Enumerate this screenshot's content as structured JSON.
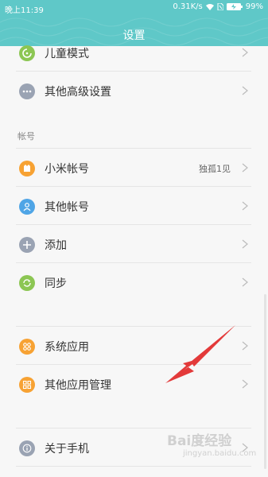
{
  "status_bar": {
    "time": "晚上11:39",
    "speed": "0.31K/s",
    "battery": "99%"
  },
  "header": {
    "title": "设置"
  },
  "settings": {
    "top_items": [
      {
        "label": "儿童模式",
        "icon": "child-mode-icon",
        "color": "#8cc653"
      },
      {
        "label": "其他高级设置",
        "icon": "more-settings-icon",
        "color": "#9aa3b3"
      }
    ],
    "account_section": {
      "title": "帐号",
      "items": [
        {
          "label": "小米帐号",
          "value": "独孤1见",
          "icon": "mi-account-icon",
          "color": "#f7a233"
        },
        {
          "label": "其他帐号",
          "icon": "user-account-icon",
          "color": "#4fa5e6"
        },
        {
          "label": "添加",
          "icon": "plus-icon",
          "color": "#9aa3b3"
        },
        {
          "label": "同步",
          "icon": "sync-icon",
          "color": "#8cc653"
        }
      ]
    },
    "apps_items": [
      {
        "label": "系统应用",
        "icon": "system-apps-icon",
        "color": "#f7a233"
      },
      {
        "label": "其他应用管理",
        "icon": "app-management-icon",
        "color": "#f7a233"
      }
    ],
    "about_item": {
      "label": "关于手机",
      "icon": "info-icon",
      "color": "#9aa3b3"
    }
  },
  "watermark": {
    "text": "Bai度经验",
    "url": "jingyan.baidu.com"
  },
  "annotation": {
    "arrow_color": "#e33a3a"
  }
}
